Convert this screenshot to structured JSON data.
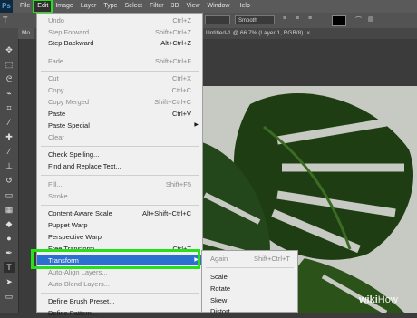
{
  "app": {
    "logo": "Ps"
  },
  "menubar": {
    "items": [
      "File",
      "Edit",
      "Image",
      "Layer",
      "Type",
      "Select",
      "Filter",
      "3D",
      "View",
      "Window",
      "Help"
    ]
  },
  "options": {
    "smoothing": "Smooth",
    "text_color": "#000000"
  },
  "tabs": {
    "first": "Mo",
    "document": "Untitled-1 @ 66.7% (Layer 1, RGB/8)",
    "close": "×"
  },
  "edit_menu": {
    "items": [
      {
        "label": "Undo",
        "shortcut": "Ctrl+Z",
        "disabled": true
      },
      {
        "label": "Step Forward",
        "shortcut": "Shift+Ctrl+Z",
        "disabled": true
      },
      {
        "label": "Step Backward",
        "shortcut": "Alt+Ctrl+Z",
        "disabled": false
      },
      {
        "label": "Fade...",
        "shortcut": "Shift+Ctrl+F",
        "disabled": true
      },
      {
        "label": "Cut",
        "shortcut": "Ctrl+X",
        "disabled": true
      },
      {
        "label": "Copy",
        "shortcut": "Ctrl+C",
        "disabled": true
      },
      {
        "label": "Copy Merged",
        "shortcut": "Shift+Ctrl+C",
        "disabled": true
      },
      {
        "label": "Paste",
        "shortcut": "Ctrl+V",
        "disabled": false
      },
      {
        "label": "Paste Special",
        "shortcut": "",
        "disabled": false
      },
      {
        "label": "Clear",
        "shortcut": "",
        "disabled": true
      },
      {
        "label": "Check Spelling...",
        "shortcut": "",
        "disabled": false
      },
      {
        "label": "Find and Replace Text...",
        "shortcut": "",
        "disabled": false
      },
      {
        "label": "Fill...",
        "shortcut": "Shift+F5",
        "disabled": true
      },
      {
        "label": "Stroke...",
        "shortcut": "",
        "disabled": true
      },
      {
        "label": "Content-Aware Scale",
        "shortcut": "Alt+Shift+Ctrl+C",
        "disabled": false
      },
      {
        "label": "Puppet Warp",
        "shortcut": "",
        "disabled": false
      },
      {
        "label": "Perspective Warp",
        "shortcut": "",
        "disabled": false
      },
      {
        "label": "Free Transform",
        "shortcut": "Ctrl+T",
        "disabled": false
      },
      {
        "label": "Transform",
        "shortcut": "",
        "disabled": false
      },
      {
        "label": "Auto-Align Layers...",
        "shortcut": "",
        "disabled": true
      },
      {
        "label": "Auto-Blend Layers...",
        "shortcut": "",
        "disabled": true
      },
      {
        "label": "Define Brush Preset...",
        "shortcut": "",
        "disabled": false
      },
      {
        "label": "Define Pattern...",
        "shortcut": "",
        "disabled": false
      }
    ],
    "highlight_color": "#2b6fd1",
    "annotation_color": "#27e01a"
  },
  "transform_submenu": {
    "items": [
      {
        "label": "Again",
        "shortcut": "Shift+Ctrl+T",
        "disabled": true
      },
      {
        "label": "Scale",
        "shortcut": "",
        "disabled": false
      },
      {
        "label": "Rotate",
        "shortcut": "",
        "disabled": false
      },
      {
        "label": "Skew",
        "shortcut": "",
        "disabled": false
      },
      {
        "label": "Distort",
        "shortcut": "",
        "disabled": false
      }
    ]
  },
  "watermark": {
    "wiki": "wiki",
    "how": "How"
  }
}
